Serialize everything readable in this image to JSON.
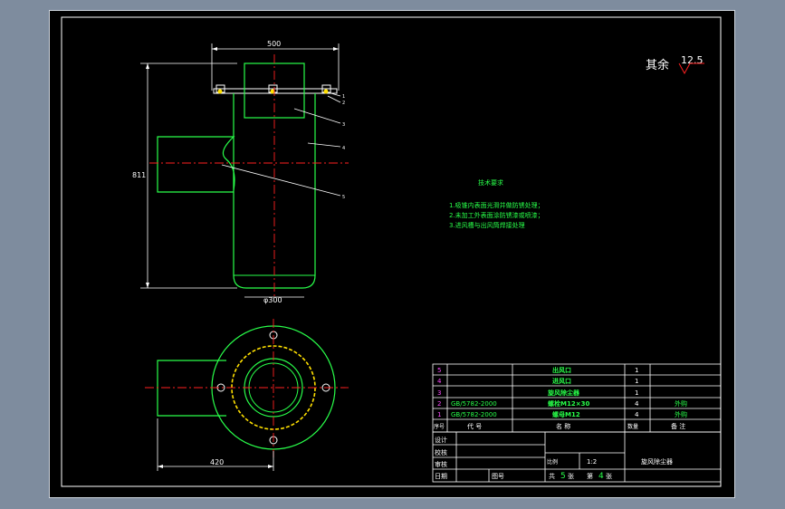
{
  "drawing": {
    "dim_top": "500",
    "dim_height": "811",
    "dim_diameter": "φ300",
    "dim_bottom": "420",
    "roughness_prefix": "其余",
    "roughness_value": "12.5",
    "callouts": [
      "1",
      "2",
      "3",
      "4",
      "5"
    ]
  },
  "tech_notes": {
    "title": "技术要求",
    "items": [
      "1.吸锥内表面光滑并做防锈处理；",
      "2.未加工外表面涂防锈漆或喷漆；",
      "3.进风槽与出风筒焊接处理"
    ]
  },
  "bom": {
    "rows": [
      {
        "no": "5",
        "code": "",
        "name": "出风口",
        "qty": "1",
        "note": ""
      },
      {
        "no": "4",
        "code": "",
        "name": "进风口",
        "qty": "1",
        "note": ""
      },
      {
        "no": "3",
        "code": "",
        "name": "旋风除尘器",
        "qty": "1",
        "note": ""
      },
      {
        "no": "2",
        "code": "GB/5782-2000",
        "name": "螺栓M12×30",
        "qty": "4",
        "note": "外购"
      },
      {
        "no": "1",
        "code": "GB/5782-2000",
        "name": "螺母M12",
        "qty": "4",
        "note": "外购"
      }
    ],
    "header": {
      "no": "序号",
      "code": "代 号",
      "name": "名 称",
      "qty": "数量",
      "note": "备 注"
    }
  },
  "title_block": {
    "labels": [
      "设计",
      "校核",
      "审核",
      "日期"
    ],
    "scale_label": "比例",
    "scale_value": "1:2",
    "drawing_name": "旋风除尘器",
    "total_prefix": "共",
    "total_value": "5",
    "total_suffix": "张",
    "sheet_prefix": "第",
    "sheet_value": "4",
    "sheet_suffix": "张",
    "weight_label": "质量",
    "code_label": "图号"
  }
}
